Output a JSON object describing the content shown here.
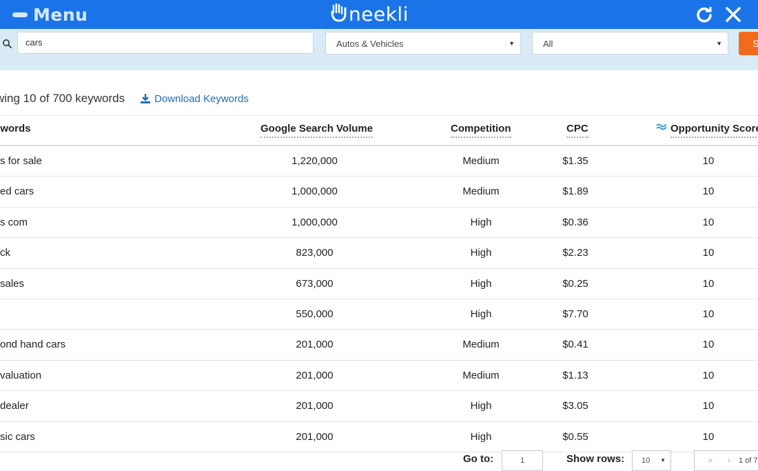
{
  "header": {
    "menu_label": "Menu",
    "logo_text": "neekli",
    "logo_letter": "U"
  },
  "search": {
    "query": "cars",
    "category": "Autos & Vehicles",
    "filter": "All",
    "button_label": "S"
  },
  "summary": {
    "text": "wing 10 of 700 keywords",
    "download_label": "Download Keywords"
  },
  "table": {
    "columns": {
      "keyword": "ywords",
      "volume": "Google Search Volume",
      "competition": "Competition",
      "cpc": "CPC",
      "opportunity": "Opportunity Score"
    },
    "rows": [
      {
        "keyword": "s for sale",
        "volume": "1,220,000",
        "competition": "Medium",
        "cpc": "$1.35",
        "opportunity": "10"
      },
      {
        "keyword": "ed cars",
        "volume": "1,000,000",
        "competition": "Medium",
        "cpc": "$1.89",
        "opportunity": "10"
      },
      {
        "keyword": "s com",
        "volume": "1,000,000",
        "competition": "High",
        "cpc": "$0.36",
        "opportunity": "10"
      },
      {
        "keyword": "ck",
        "volume": "823,000",
        "competition": "High",
        "cpc": "$2.23",
        "opportunity": "10"
      },
      {
        "keyword": " sales",
        "volume": "673,000",
        "competition": "High",
        "cpc": "$0.25",
        "opportunity": "10"
      },
      {
        "keyword": "",
        "volume": "550,000",
        "competition": "High",
        "cpc": "$7.70",
        "opportunity": "10"
      },
      {
        "keyword": "ond hand cars",
        "volume": "201,000",
        "competition": "Medium",
        "cpc": "$0.41",
        "opportunity": "10"
      },
      {
        "keyword": " valuation",
        "volume": "201,000",
        "competition": "Medium",
        "cpc": "$1.13",
        "opportunity": "10"
      },
      {
        "keyword": " dealer",
        "volume": "201,000",
        "competition": "High",
        "cpc": "$3.05",
        "opportunity": "10"
      },
      {
        "keyword": "sic cars",
        "volume": "201,000",
        "competition": "High",
        "cpc": "$0.55",
        "opportunity": "10"
      }
    ]
  },
  "footer": {
    "goto_label": "Go to:",
    "goto_value": "1",
    "rows_label": "Show rows:",
    "rows_value": "10",
    "first_symbol": "«",
    "prev_symbol": "‹",
    "page_info": "1 of 7"
  },
  "colors": {
    "header_bg": "#1a74e8",
    "strip_bg": "#d9ebf7",
    "accent_orange": "#f26b1d",
    "link_blue": "#1f6fb2"
  },
  "icons": [
    "menu-icon",
    "uneekli-logo-hand",
    "refresh-icon",
    "close-icon",
    "search-icon",
    "download-icon",
    "wave-icon",
    "caret-down-icon"
  ]
}
